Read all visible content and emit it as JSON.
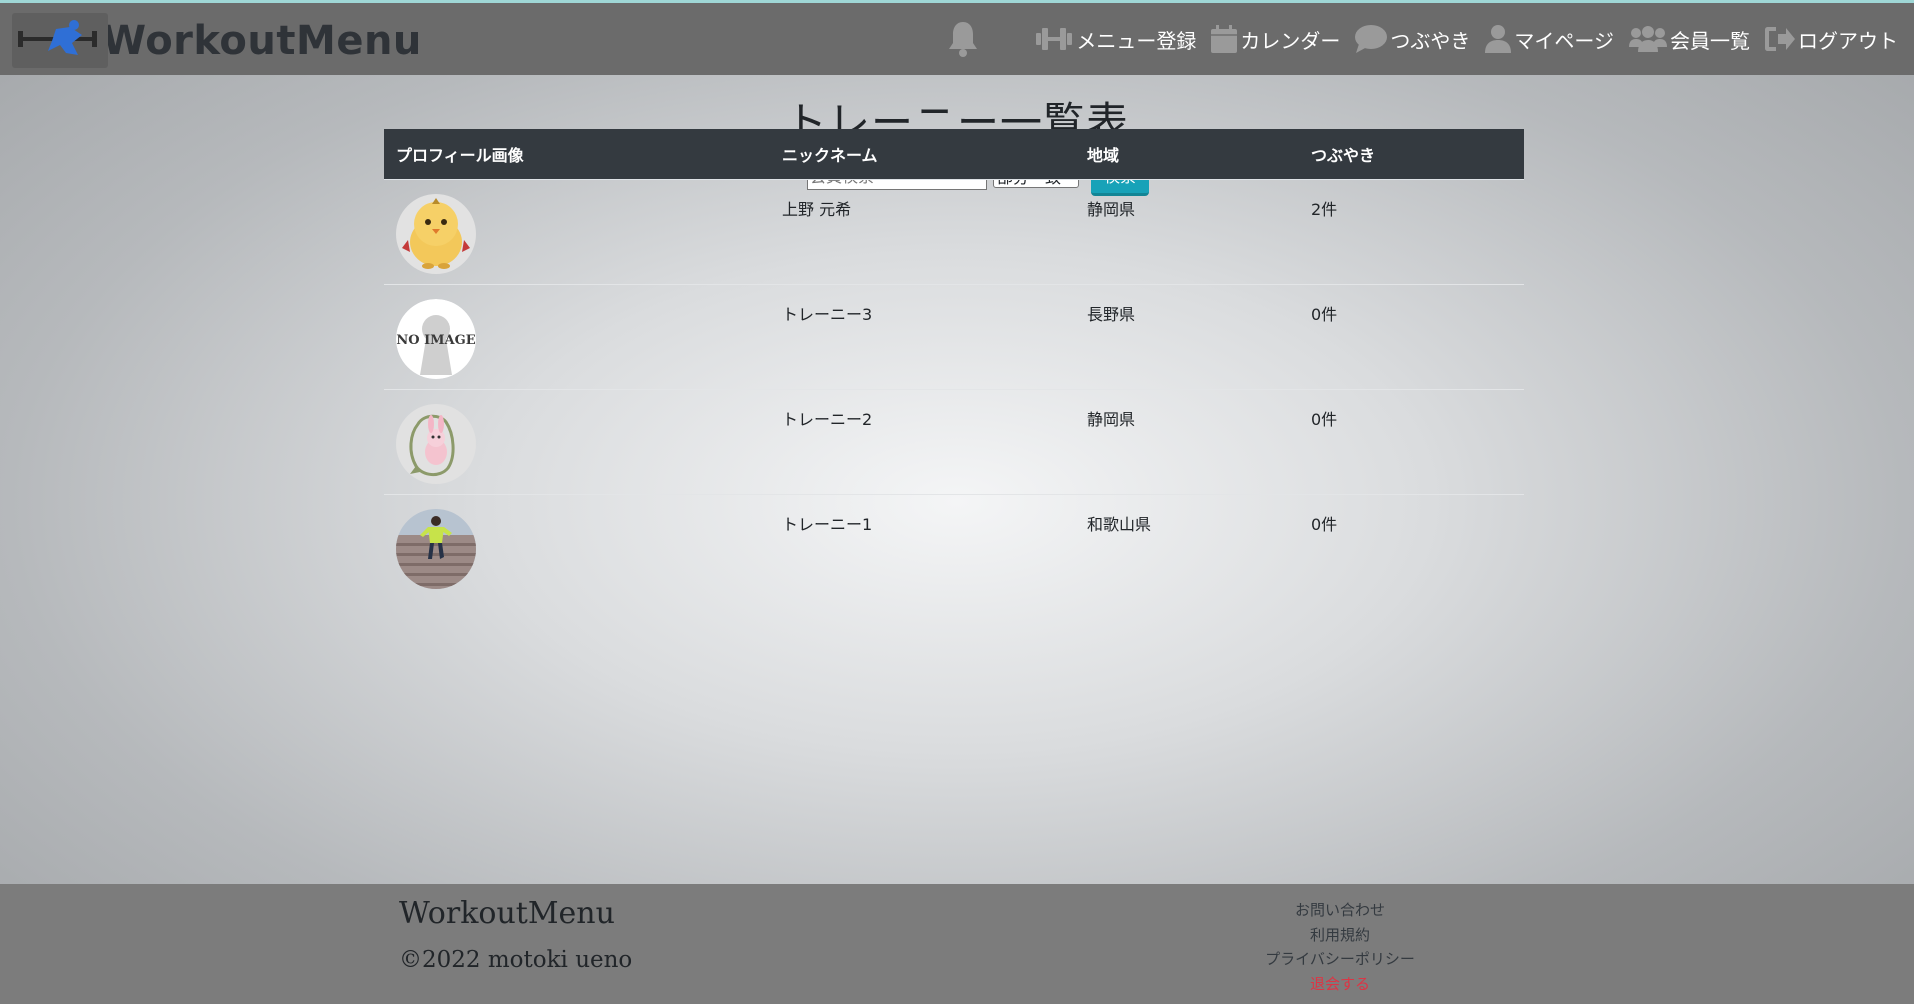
{
  "header": {
    "brand": "WorkoutMenu",
    "nav": [
      {
        "label": "メニュー登録",
        "icon": "dumbbell-icon"
      },
      {
        "label": "カレンダー",
        "icon": "calendar-icon"
      },
      {
        "label": "つぶやき",
        "icon": "comment-icon"
      },
      {
        "label": "マイページ",
        "icon": "user-icon"
      },
      {
        "label": "会員一覧",
        "icon": "users-icon"
      },
      {
        "label": "ログアウト",
        "icon": "sign-out-icon"
      }
    ],
    "bell_icon": "bell-icon"
  },
  "page": {
    "title": "トレーニー一覧表",
    "search": {
      "placeholder": "会員検索",
      "value": "",
      "match_option": "部分一致",
      "button": "検索"
    }
  },
  "table": {
    "headers": [
      "プロフィール画像",
      "ニックネーム",
      "地域",
      "つぶやき"
    ],
    "rows": [
      {
        "avatar": "chick-avatar",
        "nickname": "上野 元希",
        "region": "静岡県",
        "posts": "2件"
      },
      {
        "avatar": "no-image-avatar",
        "nickname": "トレーニー3",
        "region": "長野県",
        "posts": "0件"
      },
      {
        "avatar": "rabbit-avatar",
        "nickname": "トレーニー2",
        "region": "静岡県",
        "posts": "0件"
      },
      {
        "avatar": "runner-photo-avatar",
        "nickname": "トレーニー1",
        "region": "和歌山県",
        "posts": "0件"
      }
    ]
  },
  "footer": {
    "brand": "WorkoutMenu",
    "copyright": "©2022 motoki ueno",
    "links": [
      "お問い合わせ",
      "利用規約",
      "プライバシーポリシー"
    ],
    "withdraw": "退会する"
  },
  "colors": {
    "header_bg": "#6b6b6b",
    "table_header_bg": "#343a40",
    "search_button": "#17a2b8",
    "withdraw_link": "#dc3545"
  }
}
